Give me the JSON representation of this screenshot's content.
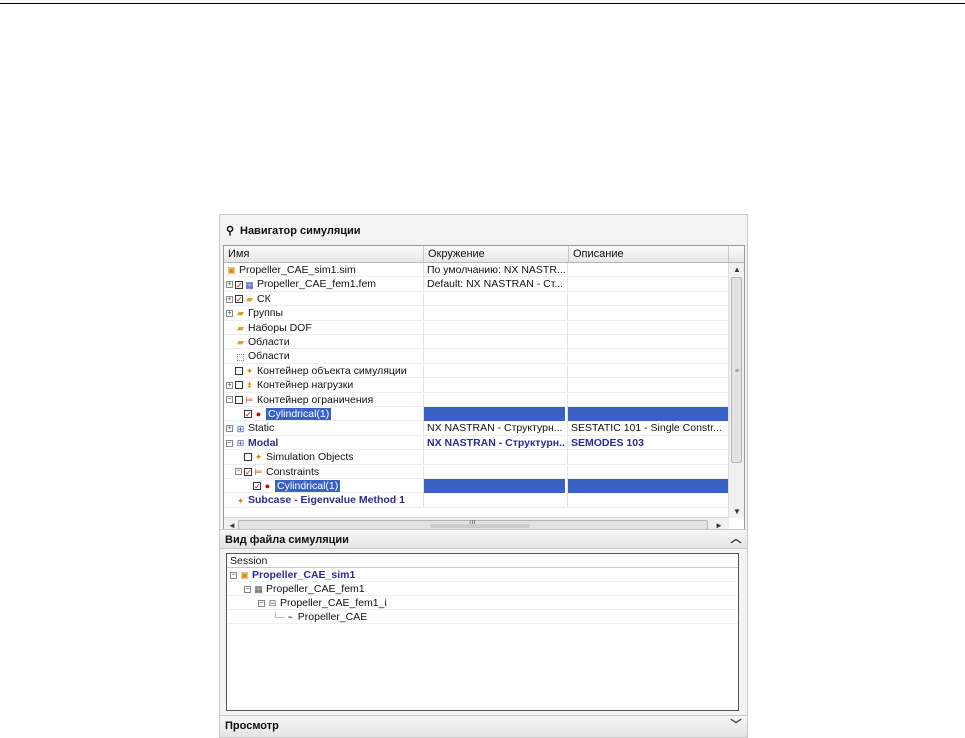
{
  "nav_title": "Навигатор симуляции",
  "columns": [
    "Имя",
    "Окружение",
    "Описание"
  ],
  "tree_rows": [
    {
      "name": "Propeller_CAE_sim1.sim",
      "env": "По умолчанию: NX NASTR...",
      "desc": "",
      "indent": 0,
      "expander": "",
      "check": "",
      "icon": "sim-file-icon",
      "glyph": "▣"
    },
    {
      "name": "Propeller_CAE_fem1.fem",
      "env": "Default: NX NASTRAN - Ст...",
      "desc": "",
      "indent": 0,
      "expander": "+",
      "check": "✓",
      "icon": "fem-file-icon",
      "glyph": "▦"
    },
    {
      "name": "СК",
      "env": "",
      "desc": "",
      "indent": 0,
      "expander": "+",
      "check": "✓",
      "icon": "folder-icon",
      "glyph": "▰"
    },
    {
      "name": "Группы",
      "env": "",
      "desc": "",
      "indent": 0,
      "expander": "+",
      "check": "",
      "icon": "folder-icon",
      "glyph": "▰"
    },
    {
      "name": "Наборы DOF",
      "env": "",
      "desc": "",
      "indent": 1,
      "expander": "",
      "check": "",
      "icon": "folder-icon",
      "glyph": "▰"
    },
    {
      "name": "Области",
      "env": "",
      "desc": "",
      "indent": 1,
      "expander": "",
      "check": "",
      "icon": "folder-icon",
      "glyph": "▰"
    },
    {
      "name": "Области",
      "env": "",
      "desc": "",
      "indent": 1,
      "expander": "",
      "check": "",
      "icon": "region-icon",
      "glyph": "⬚"
    },
    {
      "name": "Контейнер объекта симуляции",
      "env": "",
      "desc": "",
      "indent": 1,
      "expander": "",
      "check": " ",
      "icon": "simulation-object-icon",
      "glyph": "✦"
    },
    {
      "name": "Контейнер нагрузки",
      "env": "",
      "desc": "",
      "indent": 0,
      "expander": "+",
      "check": " ",
      "icon": "load-icon",
      "glyph": "⇟"
    },
    {
      "name": "Контейнер ограничения",
      "env": "",
      "desc": "",
      "indent": 0,
      "expander": "−",
      "check": " ",
      "icon": "constraint-icon",
      "glyph": "⊨"
    },
    {
      "name": "Cylindrical(1)",
      "env": "",
      "desc": "",
      "indent": 2,
      "expander": "",
      "check": "✓",
      "icon": "constraint-item-icon",
      "glyph": "●",
      "selected": true
    },
    {
      "name": "Static",
      "env": "NX NASTRAN - Структурн...",
      "desc": "SESTATIC 101 - Single Constr...",
      "indent": 0,
      "expander": "+",
      "check": "",
      "icon": "solution-icon",
      "glyph": "⊞"
    },
    {
      "name": "Modal",
      "env": "NX NASTRAN - Структурн...",
      "desc": "SEMODES 103",
      "indent": 0,
      "expander": "−",
      "check": "",
      "icon": "solution-icon",
      "glyph": "⊞",
      "bold": true
    },
    {
      "name": "Simulation Objects",
      "env": "",
      "desc": "",
      "indent": 2,
      "expander": "",
      "check": " ",
      "icon": "simulation-object-icon",
      "glyph": "✦"
    },
    {
      "name": "Constraints",
      "env": "",
      "desc": "",
      "indent": 1,
      "expander": "−",
      "check": "✓",
      "icon": "constraint-icon",
      "glyph": "⊨"
    },
    {
      "name": "Cylindrical(1)",
      "env": "",
      "desc": "",
      "indent": 3,
      "expander": "",
      "check": "✓",
      "icon": "constraint-item-icon",
      "glyph": "●",
      "selected": true
    },
    {
      "name": "Subcase - Eigenvalue Method 1",
      "env": "",
      "desc": "",
      "indent": 1,
      "expander": "",
      "check": "",
      "icon": "subcase-icon",
      "glyph": "✦",
      "bold": true
    }
  ],
  "hscroll_grip": "III",
  "vscroll_grip": "≡",
  "file_view": {
    "title": "Вид файла симуляции",
    "header": "Session",
    "rows": [
      {
        "name": "Propeller_CAE_sim1",
        "indent": 0,
        "expander": "−",
        "glyph": "▣",
        "icon": "sim-file-icon",
        "bold": true
      },
      {
        "name": "Propeller_CAE_fem1",
        "indent": 1,
        "expander": "−",
        "glyph": "▦",
        "icon": "fem-file-icon"
      },
      {
        "name": "Propeller_CAE_fem1_i",
        "indent": 2,
        "expander": "−",
        "glyph": "⊟",
        "icon": "idealized-part-icon"
      },
      {
        "name": "Propeller_CAE",
        "indent": 3,
        "expander": "",
        "glyph": "⌁",
        "icon": "part-icon"
      }
    ]
  },
  "preview": {
    "title": "Просмотр"
  },
  "colors": {
    "selection": "#3a62c4",
    "bold_text": "#2b2c8c",
    "folder": "#e0a020",
    "check": "#cc0000"
  }
}
